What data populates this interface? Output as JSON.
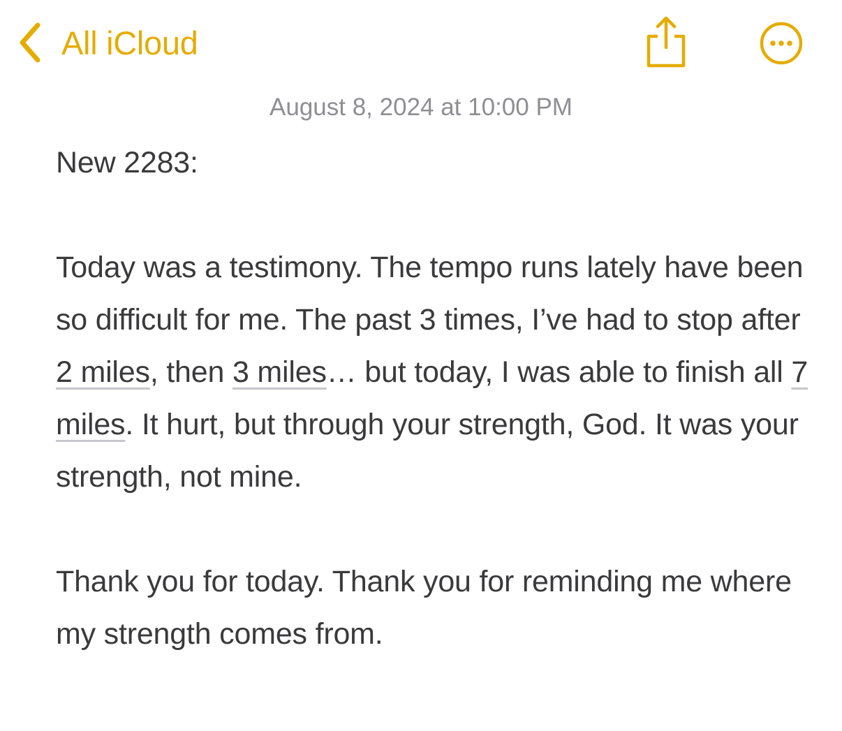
{
  "colors": {
    "accent": "#e5ac00",
    "text": "#3a3a3c",
    "secondary_text": "#8e8e93",
    "link_underline": "#c7c7cc"
  },
  "nav": {
    "back_icon": "chevron-left-icon",
    "back_label": "All iCloud",
    "share_icon": "share-icon",
    "more_icon": "ellipsis-circle-icon"
  },
  "note": {
    "date": "August 8, 2024 at 10:00 PM",
    "title": "New 2283:",
    "p1": {
      "part1": "Today was a testimony. The tempo runs lately have been so difficult for me. The past 3 times, I’ve had to stop after ",
      "link1": "2 miles",
      "part2": ", then ",
      "link2": "3 miles",
      "part3": "… but today, I was able to finish all ",
      "link3": "7 miles",
      "part4": ". It hurt, but through your strength, God. It was your strength, not mine."
    },
    "p2": "Thank you for today. Thank you for reminding me where my strength comes from."
  }
}
